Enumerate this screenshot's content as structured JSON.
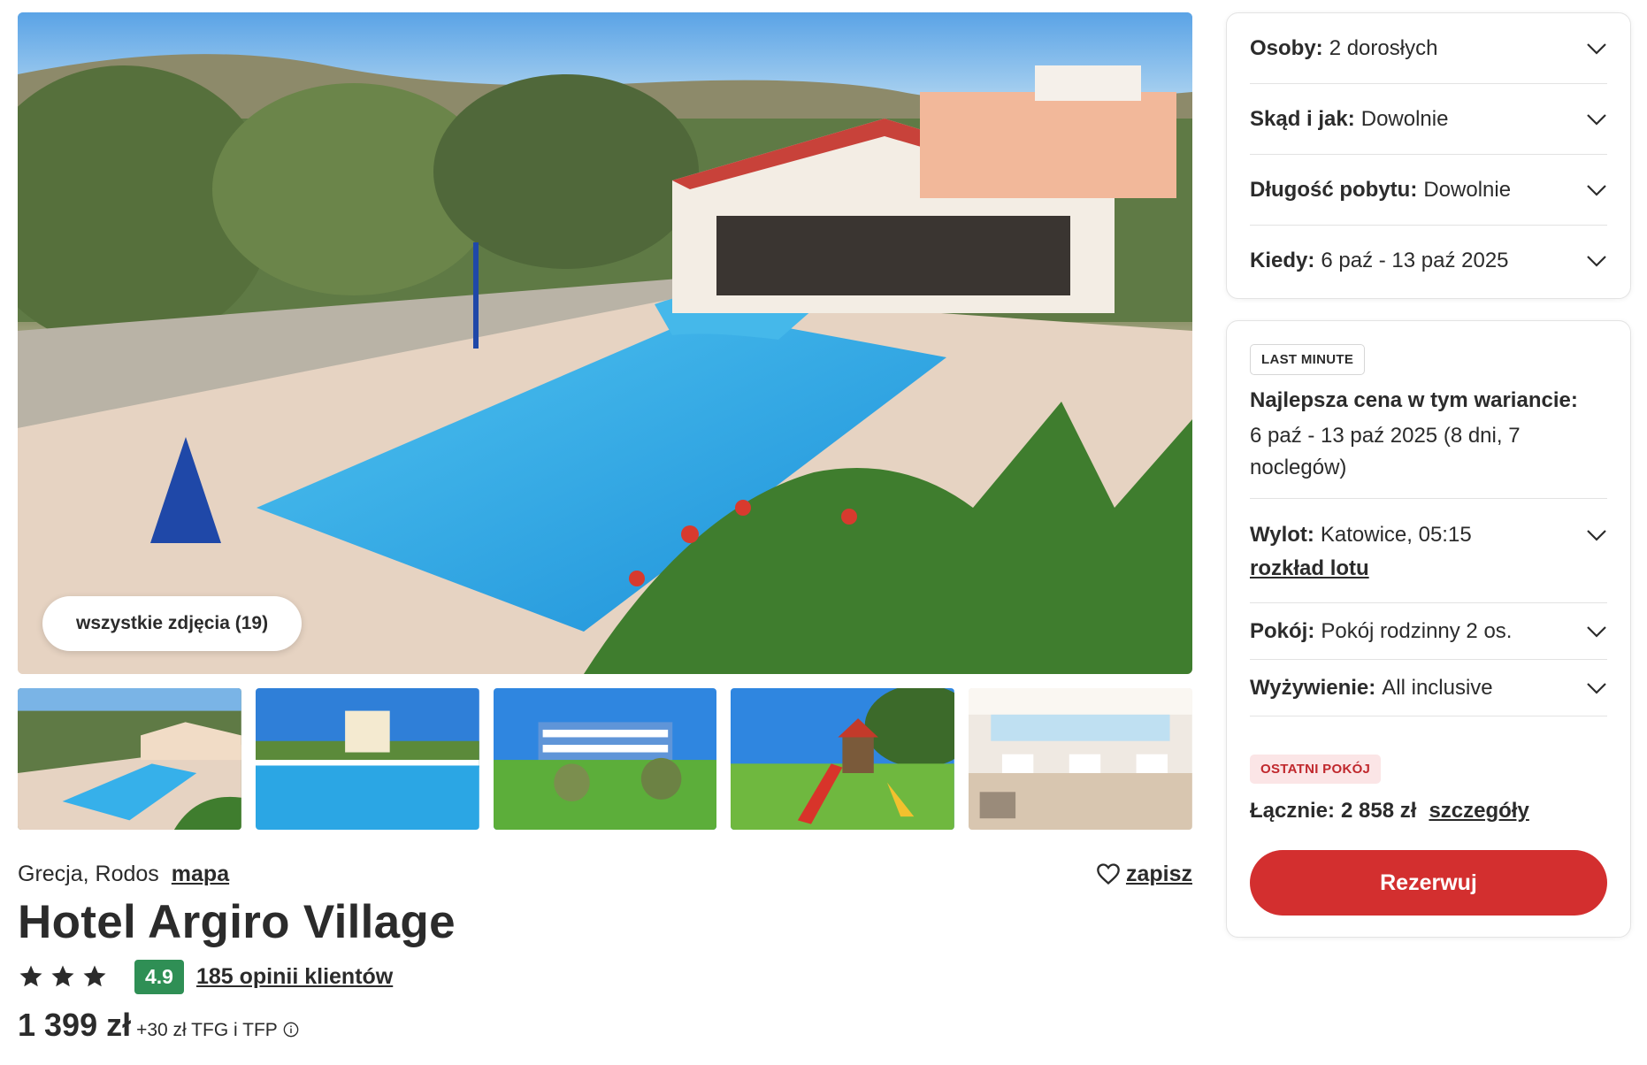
{
  "gallery": {
    "all_photos_label": "wszystkie zdjęcia (19)",
    "thumbnails": [
      "pool-and-bar",
      "pool",
      "hotel-building",
      "playground",
      "restaurant"
    ]
  },
  "hotel": {
    "location": "Grecja, Rodos",
    "map_label": "mapa",
    "save_label": "zapisz",
    "name": "Hotel Argiro Village",
    "stars": 3,
    "score": "4.9",
    "reviews_label": "185 opinii klientów",
    "price": "1 399 zł",
    "price_extra": "+30 zł TFG i TFP"
  },
  "filters": [
    {
      "key": "Osoby:",
      "value": "2 dorosłych"
    },
    {
      "key": "Skąd i jak:",
      "value": "Dowolnie"
    },
    {
      "key": "Długość pobytu:",
      "value": "Dowolnie"
    },
    {
      "key": "Kiedy:",
      "value": "6 paź - 13 paź 2025"
    }
  ],
  "offer": {
    "badge": "LAST MINUTE",
    "best_title": "Najlepsza cena w tym wariancie:",
    "best_dates": "6 paź - 13 paź 2025 (8 dni, 7 noclegów)",
    "flight_key": "Wylot:",
    "flight_value": "Katowice, 05:15",
    "schedule_label": "rozkład lotu",
    "room_key": "Pokój:",
    "room_value": "Pokój rodzinny 2 os.",
    "board_key": "Wyżywienie:",
    "board_value": "All inclusive",
    "last_room_badge": "OSTATNI POKÓJ",
    "total_key": "Łącznie:",
    "total_value": "2 858 zł",
    "details_label": "szczegóły",
    "book_label": "Rezerwuj"
  },
  "colors": {
    "accent": "#d32f2f",
    "score_badge": "#2f8f55",
    "last_room_bg": "#fbe5e6",
    "last_room_text": "#c0282d"
  }
}
